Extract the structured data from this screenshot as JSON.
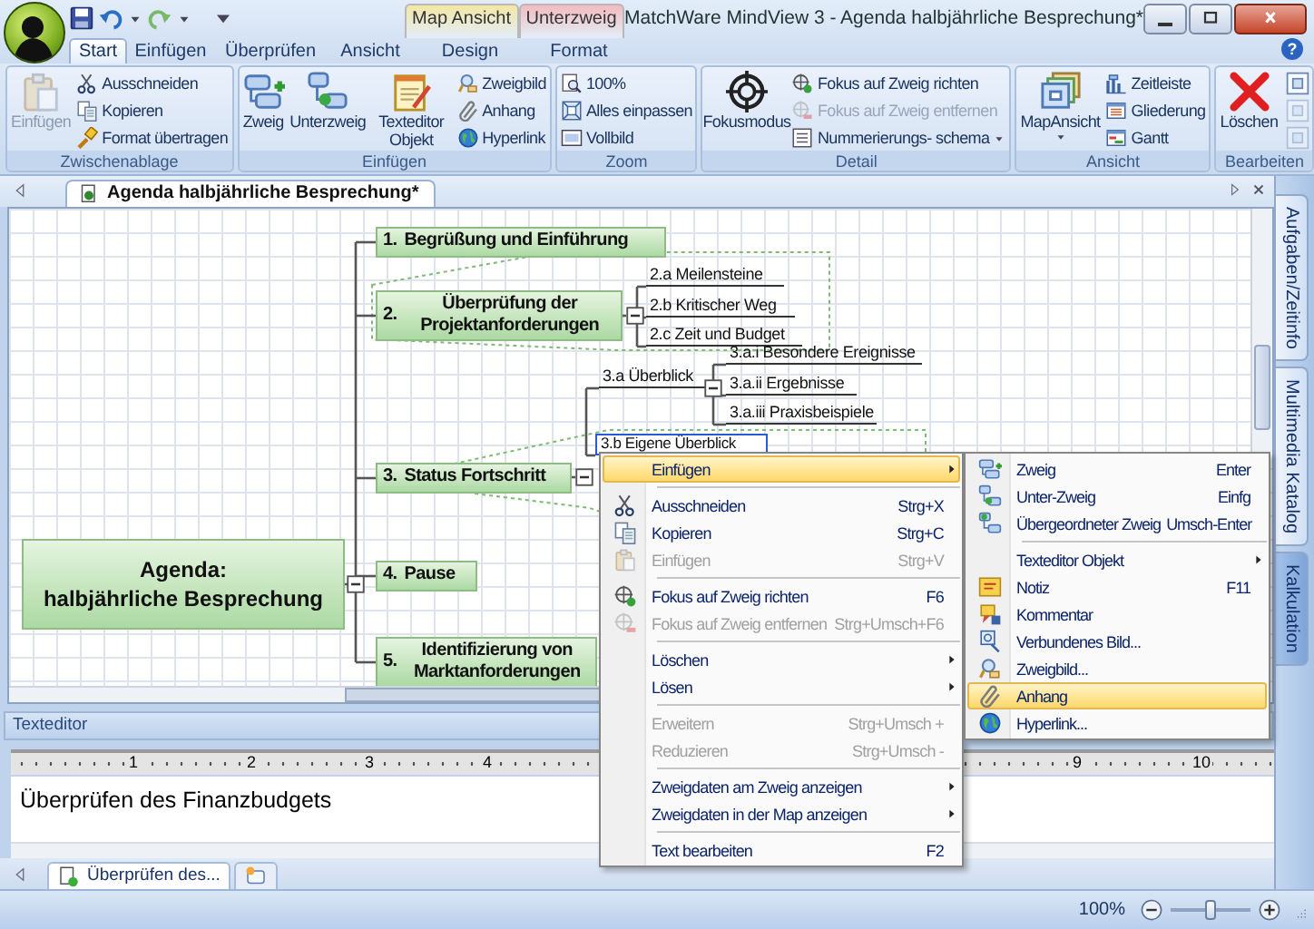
{
  "window": {
    "title": "MatchWare MindView 3 - Agenda halbjährliche Besprechung*"
  },
  "contextual_tabs": [
    {
      "label": "Map Ansicht",
      "color": "#f3e7a6"
    },
    {
      "label": "Unterzweig",
      "color": "#f2bcc0"
    }
  ],
  "tabs": [
    {
      "label": "Start",
      "selected": true
    },
    {
      "label": "Einfügen",
      "selected": false
    },
    {
      "label": "Überprüfen",
      "selected": false
    },
    {
      "label": "Ansicht",
      "selected": false
    },
    {
      "label": "Design",
      "selected": false
    },
    {
      "label": "Format",
      "selected": false
    }
  ],
  "help_button": "?",
  "ribbon": {
    "groups": [
      {
        "label": "Zwischenablage",
        "large": [
          {
            "label": "Einfügen",
            "disabled": true
          }
        ],
        "small": [
          {
            "label": "Ausschneiden",
            "disabled": false
          },
          {
            "label": "Kopieren",
            "disabled": false
          },
          {
            "label": "Format übertragen",
            "disabled": false
          }
        ]
      },
      {
        "label": "Einfügen",
        "large": [
          {
            "label": "Zweig",
            "disabled": false
          },
          {
            "label": "Unterzweig",
            "disabled": false
          },
          {
            "label": "Texteditor Objekt",
            "disabled": false
          }
        ],
        "small": [
          {
            "label": "Zweigbild",
            "disabled": false
          },
          {
            "label": "Anhang",
            "disabled": false
          },
          {
            "label": "Hyperlink",
            "disabled": false
          }
        ]
      },
      {
        "label": "Zoom",
        "small": [
          {
            "label": "100%",
            "disabled": false
          },
          {
            "label": "Alles einpassen",
            "disabled": false
          },
          {
            "label": "Vollbild",
            "disabled": false
          }
        ]
      },
      {
        "label": "Detail",
        "large": [
          {
            "label": "Fokusmodus",
            "disabled": false
          }
        ],
        "small": [
          {
            "label": "Fokus auf Zweig richten",
            "disabled": false
          },
          {
            "label": "Fokus auf Zweig entfernen",
            "disabled": true
          },
          {
            "label": "Nummerierungs- schema",
            "disabled": false,
            "dropdown": true
          }
        ]
      },
      {
        "label": "Ansicht",
        "large": [
          {
            "label": "MapAnsicht",
            "disabled": false,
            "dropdown": true
          }
        ],
        "small": [
          {
            "label": "Zeitleiste",
            "disabled": false
          },
          {
            "label": "Gliederung",
            "disabled": false
          },
          {
            "label": "Gantt",
            "disabled": false
          }
        ]
      },
      {
        "label": "Bearbeiten",
        "large": [
          {
            "label": "Löschen",
            "disabled": false
          }
        ]
      }
    ]
  },
  "document_tabs": [
    {
      "label": "Agenda halbjährliche Besprechung*",
      "selected": true
    }
  ],
  "map": {
    "central": {
      "text": "Agenda:\nhalbjährliche Besprechung",
      "selected": false,
      "expanded": true
    },
    "topics": [
      {
        "number": "1.",
        "text": "Begrüßung und Einführung",
        "selected": false
      },
      {
        "number": "2.",
        "text": "Überprüfung der Projektanforderungen",
        "selected": false,
        "expanded": true,
        "children": [
          {
            "text": "2.a  Meilensteine",
            "selected": false
          },
          {
            "text": "2.b  Kritischer Weg",
            "selected": false
          },
          {
            "text": "2.c  Zeit und Budget",
            "selected": false
          }
        ]
      },
      {
        "number": "3.",
        "text": "Status Fortschritt",
        "selected": false,
        "expanded": true,
        "children": [
          {
            "text": "3.a  Überblick",
            "selected": false,
            "expanded": true,
            "children": [
              {
                "text": "3.a.i  Besondere Ereignisse",
                "selected": false
              },
              {
                "text": "3.a.ii  Ergebnisse",
                "selected": false
              },
              {
                "text": "3.a.iii  Praxisbeispiele",
                "selected": false
              }
            ]
          },
          {
            "text": "3.b  Eigene Überblick",
            "selected": true
          }
        ]
      },
      {
        "number": "4.",
        "text": "Pause",
        "selected": false
      },
      {
        "number": "5.",
        "text": "Identifizierung von Marktanforderungen",
        "selected": false
      }
    ]
  },
  "side_tabs": [
    {
      "label": "Aufgaben/Zeitinfo"
    },
    {
      "label": "Multimedia Katalog"
    },
    {
      "label": "Kalkulation"
    }
  ],
  "text_editor": {
    "title": "Texteditor",
    "ruler": {
      "left_marks": [
        "1",
        "2",
        "3",
        "4"
      ],
      "right_marks": [
        "9",
        "10"
      ]
    },
    "content": "Überprüfen des Finanzbudgets"
  },
  "bottom_tabs": [
    {
      "kind": "document",
      "label": "Überprüfen des...",
      "selected": true
    },
    {
      "kind": "new",
      "selected": false
    }
  ],
  "status_bar": {
    "zoom_reading": "100%",
    "zoom_slider": {
      "level": 0.5
    }
  },
  "context_menu": {
    "items": [
      {
        "kind": "item",
        "label": "Einfügen",
        "highlighted": true,
        "disabled": false,
        "submenu": true
      },
      {
        "kind": "separator"
      },
      {
        "kind": "item",
        "label": "Ausschneiden",
        "shortcut": "Strg+X",
        "highlighted": false,
        "disabled": false,
        "submenu": false
      },
      {
        "kind": "item",
        "label": "Kopieren",
        "shortcut": "Strg+C",
        "highlighted": false,
        "disabled": false,
        "submenu": false
      },
      {
        "kind": "item",
        "label": "Einfügen",
        "shortcut": "Strg+V",
        "highlighted": false,
        "disabled": true,
        "submenu": false
      },
      {
        "kind": "separator"
      },
      {
        "kind": "item",
        "label": "Fokus auf Zweig richten",
        "shortcut": "F6",
        "highlighted": false,
        "disabled": false,
        "submenu": false
      },
      {
        "kind": "item",
        "label": "Fokus auf Zweig entfernen",
        "shortcut": "Strg+Umsch+F6",
        "highlighted": false,
        "disabled": true,
        "submenu": false
      },
      {
        "kind": "separator"
      },
      {
        "kind": "item",
        "label": "Löschen",
        "highlighted": false,
        "disabled": false,
        "submenu": true
      },
      {
        "kind": "item",
        "label": "Lösen",
        "highlighted": false,
        "disabled": false,
        "submenu": true
      },
      {
        "kind": "separator"
      },
      {
        "kind": "item",
        "label": "Erweitern",
        "shortcut": "Strg+Umsch +",
        "highlighted": false,
        "disabled": true,
        "submenu": false
      },
      {
        "kind": "item",
        "label": "Reduzieren",
        "shortcut": "Strg+Umsch -",
        "highlighted": false,
        "disabled": true,
        "submenu": false
      },
      {
        "kind": "separator"
      },
      {
        "kind": "item",
        "label": "Zweigdaten am Zweig anzeigen",
        "highlighted": false,
        "disabled": false,
        "submenu": true
      },
      {
        "kind": "item",
        "label": "Zweigdaten in der Map anzeigen",
        "highlighted": false,
        "disabled": false,
        "submenu": true
      },
      {
        "kind": "separator"
      },
      {
        "kind": "item",
        "label": "Text bearbeiten",
        "shortcut": "F2",
        "highlighted": false,
        "disabled": false,
        "submenu": false
      }
    ]
  },
  "submenu": {
    "items": [
      {
        "kind": "item",
        "label": "Zweig",
        "shortcut": "Enter",
        "highlighted": false,
        "disabled": false,
        "submenu": false
      },
      {
        "kind": "item",
        "label": "Unter-Zweig",
        "shortcut": "Einfg",
        "highlighted": false,
        "disabled": false,
        "submenu": false
      },
      {
        "kind": "item",
        "label": "Übergeordneter Zweig",
        "shortcut": "Umsch-Enter",
        "highlighted": false,
        "disabled": false,
        "submenu": false
      },
      {
        "kind": "separator"
      },
      {
        "kind": "item",
        "label": "Texteditor Objekt",
        "highlighted": false,
        "disabled": false,
        "submenu": true
      },
      {
        "kind": "item",
        "label": "Notiz",
        "shortcut": "F11",
        "highlighted": false,
        "disabled": false,
        "submenu": false
      },
      {
        "kind": "item",
        "label": "Kommentar",
        "highlighted": false,
        "disabled": false,
        "submenu": false
      },
      {
        "kind": "item",
        "label": "Verbundenes Bild...",
        "highlighted": false,
        "disabled": false,
        "submenu": false
      },
      {
        "kind": "item",
        "label": "Zweigbild...",
        "highlighted": false,
        "disabled": false,
        "submenu": false
      },
      {
        "kind": "item",
        "label": "Anhang",
        "highlighted": true,
        "disabled": false,
        "submenu": false
      },
      {
        "kind": "item",
        "label": "Hyperlink...",
        "highlighted": false,
        "disabled": false,
        "submenu": false
      }
    ]
  }
}
